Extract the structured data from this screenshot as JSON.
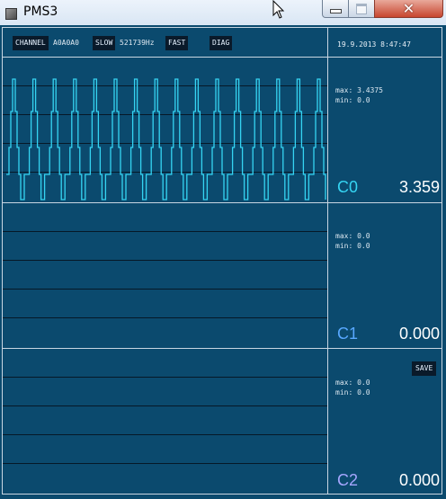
{
  "window": {
    "title": "PMS3"
  },
  "toolbar": {
    "channel_label": "CHANNEL",
    "channel_value": "A0A0A0",
    "slow_label": "SLOW",
    "frequency": "521739Hz",
    "fast_label": "FAST",
    "diag_label": "DIAG"
  },
  "datetime": "19.9.2013 8:47:47",
  "channels": [
    {
      "name": "C0",
      "max": "max: 3.4375",
      "min": "min: 0.0",
      "value": "3.359",
      "color": "#35d4f2"
    },
    {
      "name": "C1",
      "max": "max: 0.0",
      "min": "min: 0.0",
      "value": "0.000",
      "color": "#58a8ff"
    },
    {
      "name": "C2",
      "max": "max: 0.0",
      "min": "min: 0.0",
      "value": "0.000",
      "color": "#a6a6ff"
    }
  ],
  "save_label": "SAVE",
  "colors": {
    "background": "#0b4a6e",
    "trace": "#35d4f2",
    "grid": "#061827"
  }
}
